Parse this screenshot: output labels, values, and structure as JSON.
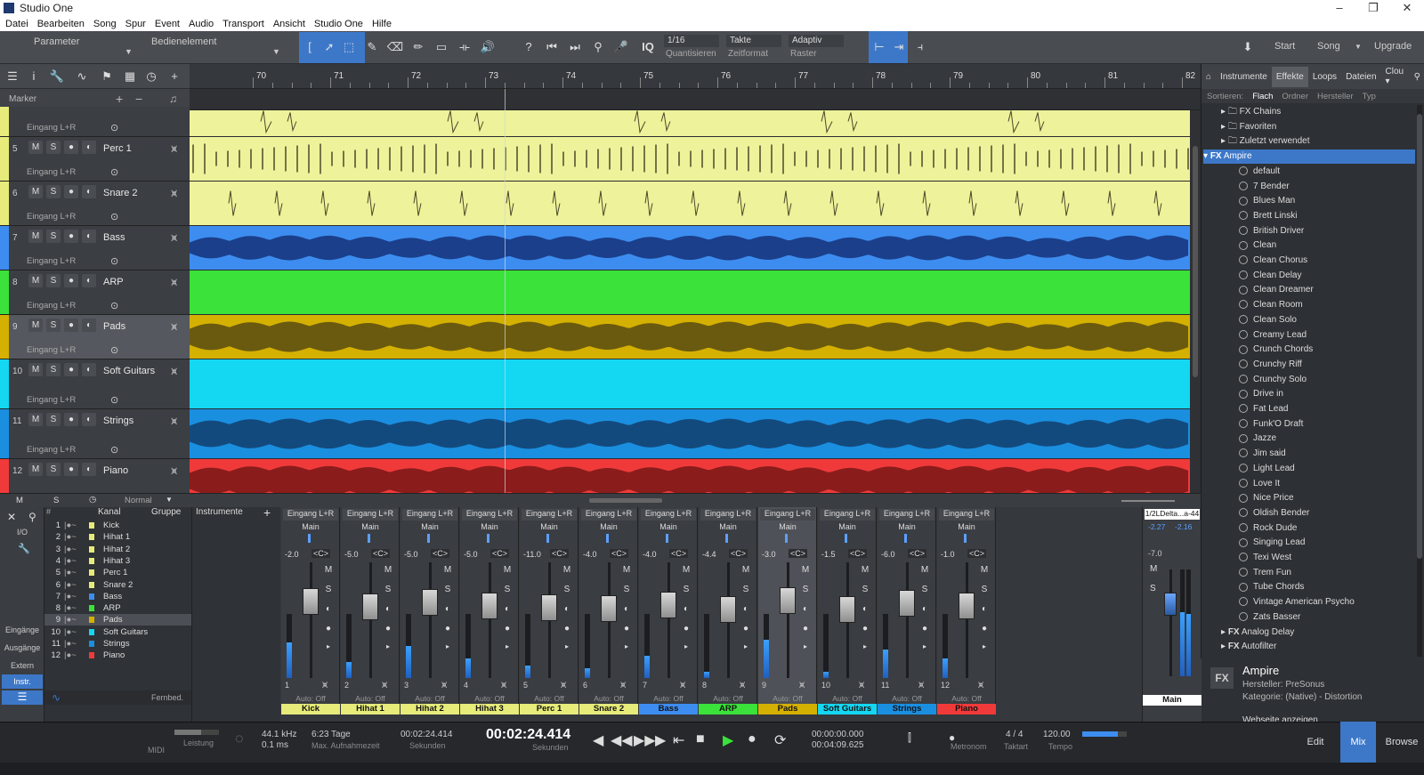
{
  "window": {
    "title": "Studio One",
    "controls": [
      "–",
      "❐",
      "✕"
    ]
  },
  "menu": [
    "Datei",
    "Bearbeiten",
    "Song",
    "Spur",
    "Event",
    "Audio",
    "Transport",
    "Ansicht",
    "Studio One",
    "Hilfe"
  ],
  "toolbar": {
    "param_label": "Parameter",
    "control_label": "Bedienelement",
    "iq": "IQ",
    "quantize_value": "1/16",
    "quantize_label": "Quantisieren",
    "timeformat_value": "Takte",
    "timeformat_label": "Zeitformat",
    "snap_value": "Adaptiv",
    "snap_label": "Raster",
    "start": "Start",
    "song": "Song",
    "upgrade": "Upgrade"
  },
  "ruler": {
    "bars": [
      "70",
      "71",
      "72",
      "73",
      "74",
      "75",
      "76",
      "77",
      "78",
      "79",
      "80",
      "81",
      "82"
    ]
  },
  "marker_label": "Marker",
  "tracks": [
    {
      "num": "",
      "name": "",
      "input": "Eingang L+R",
      "color": "#e6eb7a",
      "lane": "#eef29a",
      "wave": "#4a4a2a",
      "kind": "hits"
    },
    {
      "num": "5",
      "name": "Perc 1",
      "input": "Eingang L+R",
      "color": "#e6eb7a",
      "lane": "#eef29a",
      "wave": "#4a4a2a",
      "kind": "dense"
    },
    {
      "num": "6",
      "name": "Snare 2",
      "input": "Eingang L+R",
      "color": "#e6eb7a",
      "lane": "#eef29a",
      "wave": "#4a4a2a",
      "kind": "sparse"
    },
    {
      "num": "7",
      "name": "Bass",
      "input": "Eingang L+R",
      "color": "#3d8df0",
      "lane": "#3d8df0",
      "wave": "#1b3f8a",
      "kind": "bass"
    },
    {
      "num": "8",
      "name": "ARP",
      "input": "Eingang L+R",
      "color": "#3ae23a",
      "lane": "#3ae23a",
      "wave": "#2bb82b",
      "kind": "none"
    },
    {
      "num": "9",
      "name": "Pads",
      "input": "Eingang L+R",
      "color": "#d4b000",
      "lane": "#d4b000",
      "wave": "#6a5a10",
      "kind": "pad"
    },
    {
      "num": "10",
      "name": "Soft Guitars",
      "input": "Eingang L+R",
      "color": "#14d7f2",
      "lane": "#14d7f2",
      "wave": "#0fb8cf",
      "kind": "none"
    },
    {
      "num": "11",
      "name": "Strings",
      "input": "Eingang L+R",
      "color": "#1a8fe0",
      "lane": "#1a8fe0",
      "wave": "#134a7d",
      "kind": "pad"
    },
    {
      "num": "12",
      "name": "Piano",
      "input": "",
      "color": "#f03a3a",
      "lane": "#f03a3a",
      "wave": "#8a1c1c",
      "kind": "pad"
    }
  ],
  "track_buttons": {
    "m": "M",
    "s": "S",
    "rec": "●",
    "mon": "◐"
  },
  "tl_bottom": {
    "m": "M",
    "s": "S",
    "mode": "Normal"
  },
  "browser": {
    "tabs": [
      "Instrumente",
      "Effekte",
      "Loops",
      "Dateien",
      "Clou ▾"
    ],
    "sort_label": "Sortieren:",
    "sort_opts": [
      "Flach",
      "Ordner",
      "Hersteller",
      "Typ"
    ],
    "folders": [
      "FX Chains",
      "Favoriten",
      "Zuletzt verwendet"
    ],
    "plugin": "Ampire",
    "presets": [
      "default",
      "7 Bender",
      "Blues Man",
      "Brett Linski",
      "British Driver",
      "Clean",
      "Clean Chorus",
      "Clean Delay",
      "Clean Dreamer",
      "Clean Room",
      "Clean Solo",
      "Creamy Lead",
      "Crunch Chords",
      "Crunchy Riff",
      "Crunchy Solo",
      "Drive in",
      "Fat Lead",
      "Funk'O Draft",
      "Jazze",
      "Jim said",
      "Light Lead",
      "Love It",
      "Nice Price",
      "Oldish Bender",
      "Rock Dude",
      "Singing Lead",
      "Texi West",
      "Trem Fun",
      "Tube Chords",
      "Vintage American Psycho",
      "Zats Basser"
    ],
    "more": [
      "Analog Delay",
      "Autofilter"
    ],
    "info": {
      "badge": "FX",
      "name": "Ampire",
      "maker": "Hersteller: PreSonus",
      "category": "Kategorie: (Native) - Distortion",
      "link": "Webseite anzeigen"
    }
  },
  "mixer": {
    "nav": [
      "I/O",
      "Eingänge",
      "Ausgänge",
      "Extern",
      "Instr."
    ],
    "list_header": {
      "hash": "#",
      "channel": "Kanal",
      "group": "Gruppe"
    },
    "channels": [
      {
        "n": "1",
        "name": "Kick",
        "c": "#e6eb7a"
      },
      {
        "n": "2",
        "name": "Hihat 1",
        "c": "#e6eb7a"
      },
      {
        "n": "3",
        "name": "Hihat 2",
        "c": "#e6eb7a"
      },
      {
        "n": "4",
        "name": "Hihat 3",
        "c": "#e6eb7a"
      },
      {
        "n": "5",
        "name": "Perc 1",
        "c": "#e6eb7a"
      },
      {
        "n": "6",
        "name": "Snare 2",
        "c": "#e6eb7a"
      },
      {
        "n": "7",
        "name": "Bass",
        "c": "#3d8df0"
      },
      {
        "n": "8",
        "name": "ARP",
        "c": "#3ae23a"
      },
      {
        "n": "9",
        "name": "Pads",
        "c": "#d4b000"
      },
      {
        "n": "10",
        "name": "Soft Guitars",
        "c": "#14d7f2"
      },
      {
        "n": "11",
        "name": "Strings",
        "c": "#1a8fe0"
      },
      {
        "n": "12",
        "name": "Piano",
        "c": "#f03a3a"
      }
    ],
    "inst_label": "Instrumente",
    "fernbed": "Fernbed.",
    "strips": [
      {
        "io": "Eingang L+R",
        "out": "Main",
        "vol": "-2.0",
        "pan": "<C>",
        "n": "1",
        "label": "Kick",
        "c": "#e6eb7a",
        "level": 0.55
      },
      {
        "io": "Eingang L+R",
        "out": "Main",
        "vol": "-5.0",
        "pan": "<C>",
        "n": "2",
        "label": "Hihat 1",
        "c": "#e6eb7a",
        "level": 0.25
      },
      {
        "io": "Eingang L+R",
        "out": "Main",
        "vol": "-5.0",
        "pan": "<C>",
        "n": "3",
        "label": "Hihat 2",
        "c": "#e6eb7a",
        "level": 0.5
      },
      {
        "io": "Eingang L+R",
        "out": "Main",
        "vol": "-5.0",
        "pan": "<C>",
        "n": "4",
        "label": "Hihat 3",
        "c": "#e6eb7a",
        "level": 0.3
      },
      {
        "io": "Eingang L+R",
        "out": "Main",
        "vol": "-11.0",
        "pan": "<C>",
        "n": "5",
        "label": "Perc 1",
        "c": "#e6eb7a",
        "level": 0.2
      },
      {
        "io": "Eingang L+R",
        "out": "Main",
        "vol": "-4.0",
        "pan": "<C>",
        "n": "6",
        "label": "Snare 2",
        "c": "#e6eb7a",
        "level": 0.15
      },
      {
        "io": "Eingang L+R",
        "out": "Main",
        "vol": "-4.0",
        "pan": "<C>",
        "n": "7",
        "label": "Bass",
        "c": "#3d8df0",
        "level": 0.35
      },
      {
        "io": "Eingang L+R",
        "out": "Main",
        "vol": "-4.4",
        "pan": "<C>",
        "n": "8",
        "label": "ARP",
        "c": "#3ae23a",
        "level": 0.1
      },
      {
        "io": "Eingang L+R",
        "out": "Main",
        "vol": "-3.0",
        "pan": "<C>",
        "n": "9",
        "label": "Pads",
        "c": "#d4b000",
        "level": 0.6
      },
      {
        "io": "Eingang L+R",
        "out": "Main",
        "vol": "-1.5",
        "pan": "<C>",
        "n": "10",
        "label": "Soft Guitars",
        "c": "#14d7f2",
        "level": 0.1
      },
      {
        "io": "Eingang L+R",
        "out": "Main",
        "vol": "-6.0",
        "pan": "<C>",
        "n": "11",
        "label": "Strings",
        "c": "#1a8fe0",
        "level": 0.45
      },
      {
        "io": "Eingang L+R",
        "out": "Main",
        "vol": "-1.0",
        "pan": "<C>",
        "n": "12",
        "label": "Piano",
        "c": "#f03a3a",
        "level": 0.3
      }
    ],
    "auto": "Auto: Off",
    "main": {
      "top": "1/2LDelta...a-44",
      "peak_l": "-2.27",
      "peak_r": "-2.16",
      "vol": "-7.0",
      "label": "Main"
    }
  },
  "transport": {
    "midi": "MIDI",
    "perf": "Leistung",
    "rate": "44.1 kHz",
    "latency": "0.1 ms",
    "rec_time": "6:23 Tage",
    "rec_label": "Max. Aufnahmezeit",
    "sec_time": "00:02:24.414",
    "sec_label": "Sekunden",
    "main_time": "00:02:24.414",
    "main_label": "Sekunden",
    "loop_l": "00:00:00.000",
    "loop_r": "00:04:09.625",
    "metronome": "Metronom",
    "sig": "4 / 4",
    "sig_label": "Taktart",
    "tempo": "120.00",
    "tempo_label": "Tempo",
    "nav": [
      "Edit",
      "Mix",
      "Browse"
    ]
  }
}
